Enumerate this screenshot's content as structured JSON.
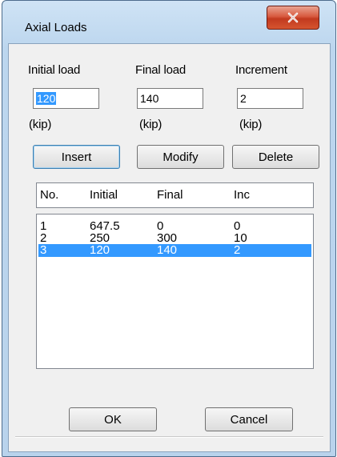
{
  "window": {
    "title": "Axial Loads",
    "close_icon": "close-icon"
  },
  "inputs": {
    "initial": {
      "label": "Initial load",
      "value": "120",
      "unit": "(kip)"
    },
    "final": {
      "label": "Final load",
      "value": "140",
      "unit": "(kip)"
    },
    "increment": {
      "label": "Increment",
      "value": "2",
      "unit": "(kip)"
    }
  },
  "buttons": {
    "insert": "Insert",
    "modify": "Modify",
    "delete": "Delete",
    "ok": "OK",
    "cancel": "Cancel"
  },
  "table": {
    "headers": [
      "No.",
      "Initial",
      "Final",
      "Inc"
    ],
    "rows": [
      {
        "no": "1",
        "initial": "647.5",
        "final": "0",
        "inc": "0"
      },
      {
        "no": "2",
        "initial": "250",
        "final": "300",
        "inc": "10"
      },
      {
        "no": "3",
        "initial": "120",
        "final": "140",
        "inc": "2"
      }
    ],
    "selected_row": 3
  },
  "colors": {
    "selection": "#3399ff",
    "close_button": "#c9452a"
  }
}
